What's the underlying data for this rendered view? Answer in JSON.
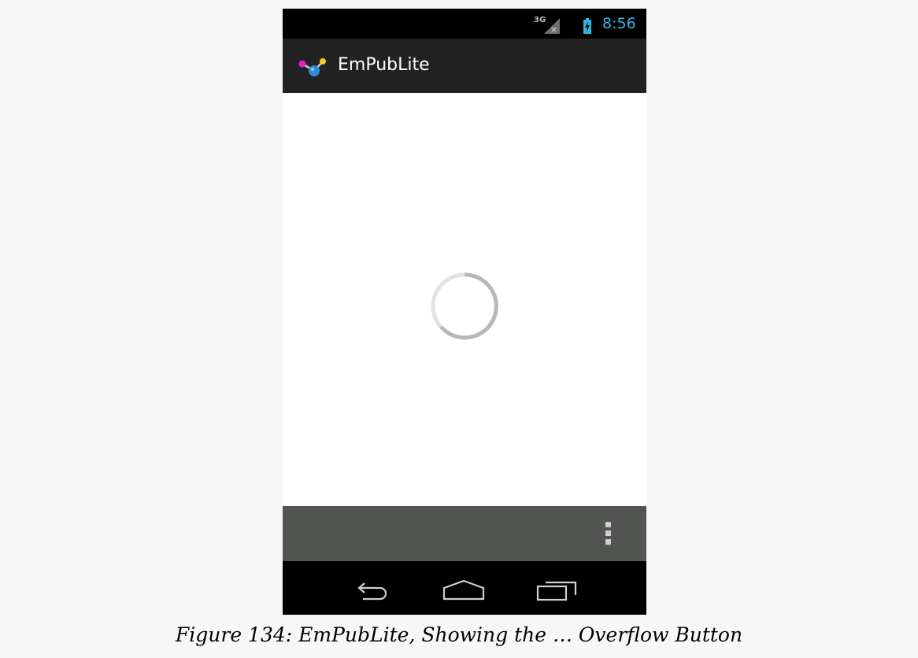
{
  "status_bar": {
    "network_label": "3G",
    "time": "8:56"
  },
  "action_bar": {
    "title": "EmPubLite",
    "icon": "empublite-app-icon"
  },
  "content": {
    "spinner": "loading-spinner-icon"
  },
  "bottom_bar": {
    "overflow_icon": "overflow-menu-icon"
  },
  "nav_bar": {
    "back_icon": "back-icon",
    "home_icon": "home-icon",
    "recents_icon": "recent-apps-icon"
  },
  "caption": {
    "text": "Figure 134: EmPubLite, Showing the … Overflow Button"
  },
  "colors": {
    "status_bar": "#000000",
    "clock": "#33b5e5",
    "action_bar": "#222222",
    "bottom_bar": "#525452",
    "nav_bar": "#000000",
    "page_background": "#f7f7f7"
  }
}
